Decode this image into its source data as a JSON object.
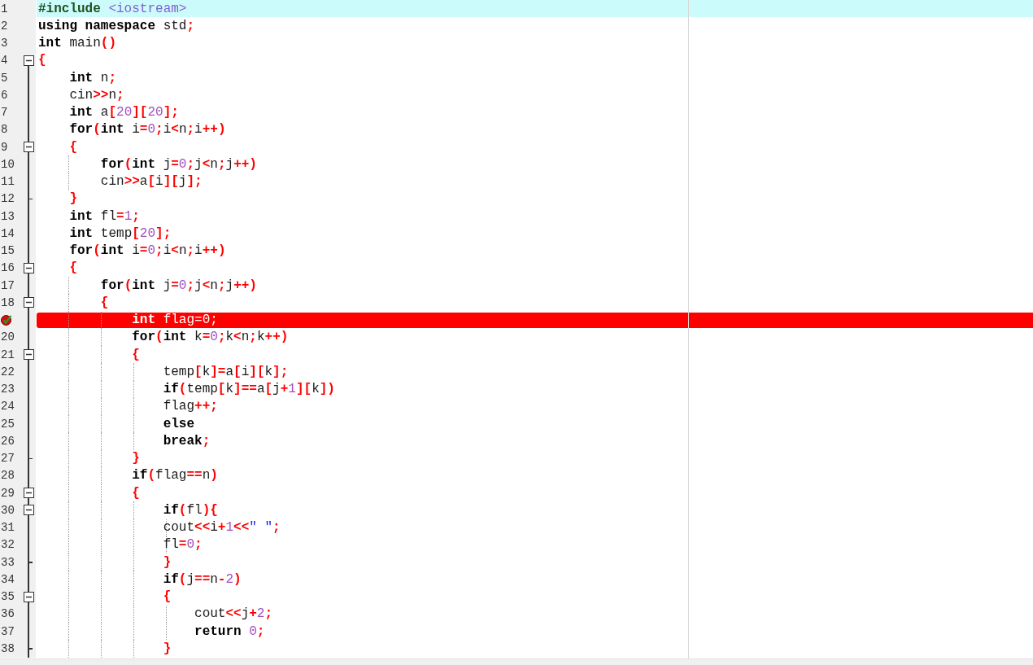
{
  "lines": [
    {
      "number": "1",
      "kind": "plain",
      "highlighted": true,
      "breakpoint": false,
      "tokens": [
        {
          "kind": "pre",
          "text": "#include"
        },
        {
          "kind": "inc",
          "text": " <iostream>"
        }
      ]
    },
    {
      "number": "2",
      "kind": "plain",
      "highlighted": false,
      "breakpoint": false,
      "tokens": [
        {
          "kind": "kw",
          "text": "using namespace"
        },
        {
          "kind": "id",
          "text": " std"
        },
        {
          "kind": "op",
          "text": ";"
        }
      ]
    },
    {
      "number": "3",
      "kind": "plain",
      "highlighted": false,
      "breakpoint": false,
      "tokens": [
        {
          "kind": "kw",
          "text": "int"
        },
        {
          "kind": "id",
          "text": " main"
        },
        {
          "kind": "op",
          "text": "()"
        }
      ]
    },
    {
      "number": "4",
      "kind": "open",
      "highlighted": false,
      "breakpoint": false,
      "tokens": [
        {
          "kind": "op",
          "text": "{"
        }
      ]
    },
    {
      "number": "5",
      "kind": "plain",
      "highlighted": false,
      "breakpoint": false,
      "tokens": [
        {
          "kind": "kw",
          "text": "    int"
        },
        {
          "kind": "id",
          "text": " n"
        },
        {
          "kind": "op",
          "text": ";"
        }
      ]
    },
    {
      "number": "6",
      "kind": "plain",
      "highlighted": false,
      "breakpoint": false,
      "tokens": [
        {
          "kind": "id",
          "text": "    cin"
        },
        {
          "kind": "op",
          "text": ">>"
        },
        {
          "kind": "id",
          "text": "n"
        },
        {
          "kind": "op",
          "text": ";"
        }
      ]
    },
    {
      "number": "7",
      "kind": "plain",
      "highlighted": false,
      "breakpoint": false,
      "tokens": [
        {
          "kind": "kw",
          "text": "    int"
        },
        {
          "kind": "id",
          "text": " a"
        },
        {
          "kind": "op",
          "text": "["
        },
        {
          "kind": "num",
          "text": "20"
        },
        {
          "kind": "op",
          "text": "]["
        },
        {
          "kind": "num",
          "text": "20"
        },
        {
          "kind": "op",
          "text": "];"
        }
      ]
    },
    {
      "number": "8",
      "kind": "plain",
      "highlighted": false,
      "breakpoint": false,
      "tokens": [
        {
          "kind": "kw",
          "text": "    for"
        },
        {
          "kind": "op",
          "text": "("
        },
        {
          "kind": "kw",
          "text": "int"
        },
        {
          "kind": "id",
          "text": " i"
        },
        {
          "kind": "op",
          "text": "="
        },
        {
          "kind": "num",
          "text": "0"
        },
        {
          "kind": "op",
          "text": ";"
        },
        {
          "kind": "id",
          "text": "i"
        },
        {
          "kind": "op",
          "text": "<"
        },
        {
          "kind": "id",
          "text": "n"
        },
        {
          "kind": "op",
          "text": ";"
        },
        {
          "kind": "id",
          "text": "i"
        },
        {
          "kind": "op",
          "text": "++)"
        }
      ]
    },
    {
      "number": "9",
      "kind": "open",
      "highlighted": false,
      "breakpoint": false,
      "tokens": [
        {
          "kind": "op",
          "text": "    {"
        }
      ]
    },
    {
      "number": "10",
      "kind": "plain",
      "highlighted": false,
      "breakpoint": false,
      "tokens": [
        {
          "kind": "kw",
          "text": "        for"
        },
        {
          "kind": "op",
          "text": "("
        },
        {
          "kind": "kw",
          "text": "int"
        },
        {
          "kind": "id",
          "text": " j"
        },
        {
          "kind": "op",
          "text": "="
        },
        {
          "kind": "num",
          "text": "0"
        },
        {
          "kind": "op",
          "text": ";"
        },
        {
          "kind": "id",
          "text": "j"
        },
        {
          "kind": "op",
          "text": "<"
        },
        {
          "kind": "id",
          "text": "n"
        },
        {
          "kind": "op",
          "text": ";"
        },
        {
          "kind": "id",
          "text": "j"
        },
        {
          "kind": "op",
          "text": "++)"
        }
      ]
    },
    {
      "number": "11",
      "kind": "plain",
      "highlighted": false,
      "breakpoint": false,
      "tokens": [
        {
          "kind": "id",
          "text": "        cin"
        },
        {
          "kind": "op",
          "text": ">>"
        },
        {
          "kind": "id",
          "text": "a"
        },
        {
          "kind": "op",
          "text": "["
        },
        {
          "kind": "id",
          "text": "i"
        },
        {
          "kind": "op",
          "text": "]["
        },
        {
          "kind": "id",
          "text": "j"
        },
        {
          "kind": "op",
          "text": "];"
        }
      ]
    },
    {
      "number": "12",
      "kind": "close",
      "highlighted": false,
      "breakpoint": false,
      "tokens": [
        {
          "kind": "op",
          "text": "    }"
        }
      ]
    },
    {
      "number": "13",
      "kind": "plain",
      "highlighted": false,
      "breakpoint": false,
      "tokens": [
        {
          "kind": "kw",
          "text": "    int"
        },
        {
          "kind": "id",
          "text": " fl"
        },
        {
          "kind": "op",
          "text": "="
        },
        {
          "kind": "num",
          "text": "1"
        },
        {
          "kind": "op",
          "text": ";"
        }
      ]
    },
    {
      "number": "14",
      "kind": "plain",
      "highlighted": false,
      "breakpoint": false,
      "tokens": [
        {
          "kind": "kw",
          "text": "    int"
        },
        {
          "kind": "id",
          "text": " temp"
        },
        {
          "kind": "op",
          "text": "["
        },
        {
          "kind": "num",
          "text": "20"
        },
        {
          "kind": "op",
          "text": "];"
        }
      ]
    },
    {
      "number": "15",
      "kind": "plain",
      "highlighted": false,
      "breakpoint": false,
      "tokens": [
        {
          "kind": "kw",
          "text": "    for"
        },
        {
          "kind": "op",
          "text": "("
        },
        {
          "kind": "kw",
          "text": "int"
        },
        {
          "kind": "id",
          "text": " i"
        },
        {
          "kind": "op",
          "text": "="
        },
        {
          "kind": "num",
          "text": "0"
        },
        {
          "kind": "op",
          "text": ";"
        },
        {
          "kind": "id",
          "text": "i"
        },
        {
          "kind": "op",
          "text": "<"
        },
        {
          "kind": "id",
          "text": "n"
        },
        {
          "kind": "op",
          "text": ";"
        },
        {
          "kind": "id",
          "text": "i"
        },
        {
          "kind": "op",
          "text": "++)"
        }
      ]
    },
    {
      "number": "16",
      "kind": "open",
      "highlighted": false,
      "breakpoint": false,
      "tokens": [
        {
          "kind": "op",
          "text": "    {"
        }
      ]
    },
    {
      "number": "17",
      "kind": "plain",
      "highlighted": false,
      "breakpoint": false,
      "tokens": [
        {
          "kind": "kw",
          "text": "        for"
        },
        {
          "kind": "op",
          "text": "("
        },
        {
          "kind": "kw",
          "text": "int"
        },
        {
          "kind": "id",
          "text": " j"
        },
        {
          "kind": "op",
          "text": "="
        },
        {
          "kind": "num",
          "text": "0"
        },
        {
          "kind": "op",
          "text": ";"
        },
        {
          "kind": "id",
          "text": "j"
        },
        {
          "kind": "op",
          "text": "<"
        },
        {
          "kind": "id",
          "text": "n"
        },
        {
          "kind": "op",
          "text": ";"
        },
        {
          "kind": "id",
          "text": "j"
        },
        {
          "kind": "op",
          "text": "++)"
        }
      ]
    },
    {
      "number": "18",
      "kind": "open",
      "highlighted": false,
      "breakpoint": false,
      "tokens": [
        {
          "kind": "op",
          "text": "        {"
        }
      ]
    },
    {
      "kind": "plain",
      "highlighted": false,
      "breakpoint": true,
      "tokens": [
        {
          "kind": "kw",
          "text": "            int"
        },
        {
          "kind": "id",
          "text": " flag"
        },
        {
          "kind": "op",
          "text": "="
        },
        {
          "kind": "num",
          "text": "0"
        },
        {
          "kind": "op",
          "text": ";"
        }
      ]
    },
    {
      "number": "20",
      "kind": "plain",
      "highlighted": false,
      "breakpoint": false,
      "tokens": [
        {
          "kind": "kw",
          "text": "            for"
        },
        {
          "kind": "op",
          "text": "("
        },
        {
          "kind": "kw",
          "text": "int"
        },
        {
          "kind": "id",
          "text": " k"
        },
        {
          "kind": "op",
          "text": "="
        },
        {
          "kind": "num",
          "text": "0"
        },
        {
          "kind": "op",
          "text": ";"
        },
        {
          "kind": "id",
          "text": "k"
        },
        {
          "kind": "op",
          "text": "<"
        },
        {
          "kind": "id",
          "text": "n"
        },
        {
          "kind": "op",
          "text": ";"
        },
        {
          "kind": "id",
          "text": "k"
        },
        {
          "kind": "op",
          "text": "++)"
        }
      ]
    },
    {
      "number": "21",
      "kind": "open",
      "highlighted": false,
      "breakpoint": false,
      "tokens": [
        {
          "kind": "op",
          "text": "            {"
        }
      ]
    },
    {
      "number": "22",
      "kind": "plain",
      "highlighted": false,
      "breakpoint": false,
      "tokens": [
        {
          "kind": "id",
          "text": "                temp"
        },
        {
          "kind": "op",
          "text": "["
        },
        {
          "kind": "id",
          "text": "k"
        },
        {
          "kind": "op",
          "text": "]="
        },
        {
          "kind": "id",
          "text": "a"
        },
        {
          "kind": "op",
          "text": "["
        },
        {
          "kind": "id",
          "text": "i"
        },
        {
          "kind": "op",
          "text": "]["
        },
        {
          "kind": "id",
          "text": "k"
        },
        {
          "kind": "op",
          "text": "];"
        }
      ]
    },
    {
      "number": "23",
      "kind": "plain",
      "highlighted": false,
      "breakpoint": false,
      "tokens": [
        {
          "kind": "kw",
          "text": "                if"
        },
        {
          "kind": "op",
          "text": "("
        },
        {
          "kind": "id",
          "text": "temp"
        },
        {
          "kind": "op",
          "text": "["
        },
        {
          "kind": "id",
          "text": "k"
        },
        {
          "kind": "op",
          "text": "]=="
        },
        {
          "kind": "id",
          "text": "a"
        },
        {
          "kind": "op",
          "text": "["
        },
        {
          "kind": "id",
          "text": "j"
        },
        {
          "kind": "op",
          "text": "+"
        },
        {
          "kind": "num",
          "text": "1"
        },
        {
          "kind": "op",
          "text": "]["
        },
        {
          "kind": "id",
          "text": "k"
        },
        {
          "kind": "op",
          "text": "])"
        }
      ]
    },
    {
      "number": "24",
      "kind": "plain",
      "highlighted": false,
      "breakpoint": false,
      "tokens": [
        {
          "kind": "id",
          "text": "                flag"
        },
        {
          "kind": "op",
          "text": "++;"
        }
      ]
    },
    {
      "number": "25",
      "kind": "plain",
      "highlighted": false,
      "breakpoint": false,
      "tokens": [
        {
          "kind": "kw",
          "text": "                else"
        }
      ]
    },
    {
      "number": "26",
      "kind": "plain",
      "highlighted": false,
      "breakpoint": false,
      "tokens": [
        {
          "kind": "kw",
          "text": "                break"
        },
        {
          "kind": "op",
          "text": ";"
        }
      ]
    },
    {
      "number": "27",
      "kind": "close",
      "highlighted": false,
      "breakpoint": false,
      "tokens": [
        {
          "kind": "op",
          "text": "            }"
        }
      ]
    },
    {
      "number": "28",
      "kind": "plain",
      "highlighted": false,
      "breakpoint": false,
      "tokens": [
        {
          "kind": "kw",
          "text": "            if"
        },
        {
          "kind": "op",
          "text": "("
        },
        {
          "kind": "id",
          "text": "flag"
        },
        {
          "kind": "op",
          "text": "=="
        },
        {
          "kind": "id",
          "text": "n"
        },
        {
          "kind": "op",
          "text": ")"
        }
      ]
    },
    {
      "number": "29",
      "kind": "open",
      "highlighted": false,
      "breakpoint": false,
      "tokens": [
        {
          "kind": "op",
          "text": "            {"
        }
      ]
    },
    {
      "number": "30",
      "kind": "open",
      "highlighted": false,
      "breakpoint": false,
      "tokens": [
        {
          "kind": "kw",
          "text": "                if"
        },
        {
          "kind": "op",
          "text": "("
        },
        {
          "kind": "id",
          "text": "fl"
        },
        {
          "kind": "op",
          "text": "){"
        }
      ]
    },
    {
      "number": "31",
      "kind": "plain",
      "highlighted": false,
      "breakpoint": false,
      "tokens": [
        {
          "kind": "id",
          "text": "                cout"
        },
        {
          "kind": "op",
          "text": "<<"
        },
        {
          "kind": "id",
          "text": "i"
        },
        {
          "kind": "op",
          "text": "+"
        },
        {
          "kind": "num",
          "text": "1"
        },
        {
          "kind": "op",
          "text": "<<"
        },
        {
          "kind": "str",
          "text": "\" \""
        },
        {
          "kind": "op",
          "text": ";"
        }
      ]
    },
    {
      "number": "32",
      "kind": "plain",
      "highlighted": false,
      "breakpoint": false,
      "tokens": [
        {
          "kind": "id",
          "text": "                fl"
        },
        {
          "kind": "op",
          "text": "="
        },
        {
          "kind": "num",
          "text": "0"
        },
        {
          "kind": "op",
          "text": ";"
        }
      ]
    },
    {
      "number": "33",
      "kind": "close",
      "highlighted": false,
      "breakpoint": false,
      "tokens": [
        {
          "kind": "op",
          "text": "                }"
        }
      ]
    },
    {
      "number": "34",
      "kind": "plain",
      "highlighted": false,
      "breakpoint": false,
      "tokens": [
        {
          "kind": "kw",
          "text": "                if"
        },
        {
          "kind": "op",
          "text": "("
        },
        {
          "kind": "id",
          "text": "j"
        },
        {
          "kind": "op",
          "text": "=="
        },
        {
          "kind": "id",
          "text": "n"
        },
        {
          "kind": "op",
          "text": "-"
        },
        {
          "kind": "num",
          "text": "2"
        },
        {
          "kind": "op",
          "text": ")"
        }
      ]
    },
    {
      "number": "35",
      "kind": "open",
      "highlighted": false,
      "breakpoint": false,
      "tokens": [
        {
          "kind": "op",
          "text": "                {"
        }
      ]
    },
    {
      "number": "36",
      "kind": "plain",
      "highlighted": false,
      "breakpoint": false,
      "tokens": [
        {
          "kind": "id",
          "text": "                    cout"
        },
        {
          "kind": "op",
          "text": "<<"
        },
        {
          "kind": "id",
          "text": "j"
        },
        {
          "kind": "op",
          "text": "+"
        },
        {
          "kind": "num",
          "text": "2"
        },
        {
          "kind": "op",
          "text": ";"
        }
      ]
    },
    {
      "number": "37",
      "kind": "plain",
      "highlighted": false,
      "breakpoint": false,
      "tokens": [
        {
          "kind": "kw",
          "text": "                    return"
        },
        {
          "kind": "num",
          "text": " 0"
        },
        {
          "kind": "op",
          "text": ";"
        }
      ]
    },
    {
      "number": "38",
      "kind": "close",
      "highlighted": false,
      "breakpoint": false,
      "tokens": [
        {
          "kind": "op",
          "text": "                }"
        }
      ]
    }
  ]
}
